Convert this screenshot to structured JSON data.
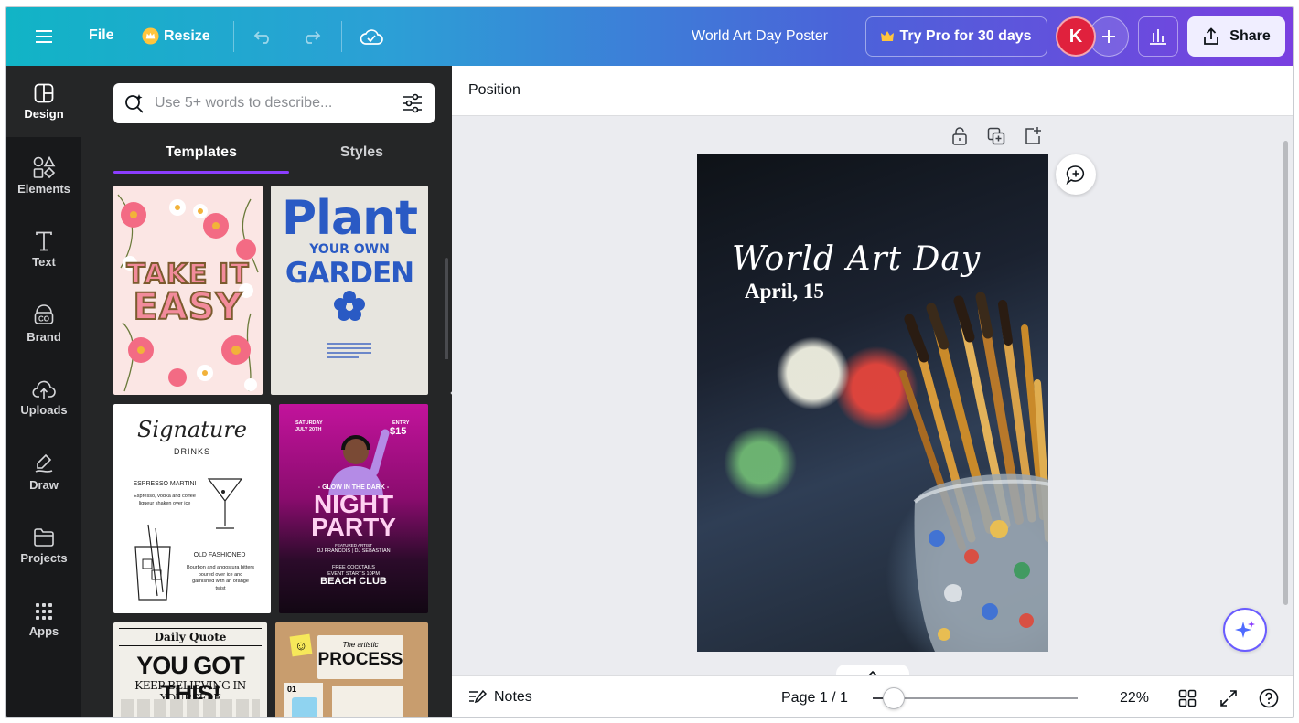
{
  "header": {
    "menu_icon": "hamburger-icon",
    "file_label": "File",
    "resize_label": "Resize",
    "document_title": "World Art Day Poster",
    "pro_label": "Try Pro for 30 days",
    "avatar_initial": "K",
    "share_label": "Share",
    "accent_gradient": [
      "#11b4c6",
      "#4b63d9",
      "#7a3fe0"
    ]
  },
  "rail": {
    "items": [
      {
        "label": "Design",
        "icon": "layout-icon"
      },
      {
        "label": "Elements",
        "icon": "shapes-icon"
      },
      {
        "label": "Text",
        "icon": "text-icon"
      },
      {
        "label": "Brand",
        "icon": "brand-icon"
      },
      {
        "label": "Uploads",
        "icon": "cloud-upload-icon"
      },
      {
        "label": "Draw",
        "icon": "pen-icon"
      },
      {
        "label": "Projects",
        "icon": "folder-icon"
      },
      {
        "label": "Apps",
        "icon": "grid-icon"
      }
    ]
  },
  "panel": {
    "search_placeholder": "Use 5+ words to describe...",
    "tabs": [
      {
        "label": "Templates"
      },
      {
        "label": "Styles"
      }
    ],
    "active_tab_color": "#8b3dff",
    "templates": {
      "t1": {
        "lines": [
          "TAKE IT",
          "EASY"
        ]
      },
      "t2": {
        "lines": [
          "Plant",
          "YOUR OWN",
          "GARDEN"
        ]
      },
      "t3": {
        "title": "Signature",
        "subtitle": "DRINKS",
        "item1": "ESPRESSO MARTINI",
        "item1_desc": "Espresso, vodka and coffee liqueur shaken over ice",
        "item2": "OLD FASHIONED",
        "item2_desc": "Bourbon and angostura bitters poured over ice and garnished with an orange twist"
      },
      "t4": {
        "date": "SATURDAY JULY 20TH",
        "entry": "ENTRY",
        "price": "$15",
        "tagline": "- GLOW IN THE DARK -",
        "line1": "NIGHT",
        "line2": "PARTY",
        "featuring": "FEATURED ARTIST",
        "artists": "DJ FRANCOIS | DJ SEBASTIAN",
        "perks": "FREE COCKTAILS",
        "start": "EVENT STARTS 10PM",
        "venue": "BEACH CLUB"
      },
      "t5": {
        "header": "Daily Quote",
        "line1": "YOU GOT THIS!",
        "line2": "KEEP BELIEVING IN YOURSELF"
      },
      "t6": {
        "small": "The artistic",
        "big": "PROCESS",
        "num": "01"
      }
    }
  },
  "editor": {
    "context_label": "Position",
    "canvas": {
      "title": "World Art Day",
      "date": "April, 15"
    }
  },
  "footer": {
    "notes_label": "Notes",
    "page_label": "Page 1 / 1",
    "zoom_label": "22%",
    "zoom_fraction": 0.22
  }
}
